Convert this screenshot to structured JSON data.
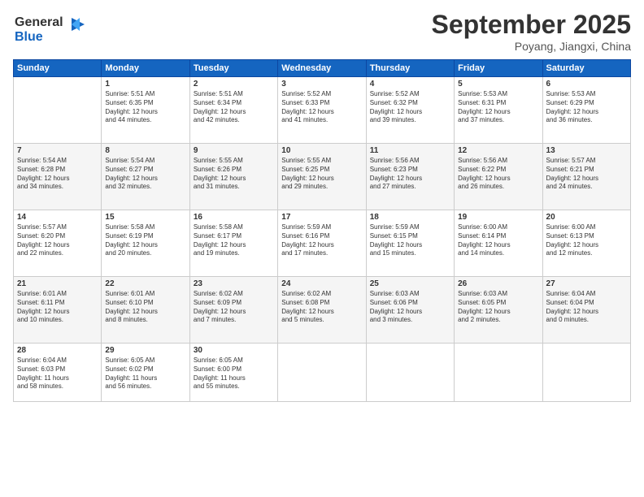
{
  "header": {
    "logo_line1": "General",
    "logo_line2": "Blue",
    "month": "September 2025",
    "location": "Poyang, Jiangxi, China"
  },
  "days_of_week": [
    "Sunday",
    "Monday",
    "Tuesday",
    "Wednesday",
    "Thursday",
    "Friday",
    "Saturday"
  ],
  "weeks": [
    [
      {
        "day": "",
        "info": ""
      },
      {
        "day": "1",
        "info": "Sunrise: 5:51 AM\nSunset: 6:35 PM\nDaylight: 12 hours\nand 44 minutes."
      },
      {
        "day": "2",
        "info": "Sunrise: 5:51 AM\nSunset: 6:34 PM\nDaylight: 12 hours\nand 42 minutes."
      },
      {
        "day": "3",
        "info": "Sunrise: 5:52 AM\nSunset: 6:33 PM\nDaylight: 12 hours\nand 41 minutes."
      },
      {
        "day": "4",
        "info": "Sunrise: 5:52 AM\nSunset: 6:32 PM\nDaylight: 12 hours\nand 39 minutes."
      },
      {
        "day": "5",
        "info": "Sunrise: 5:53 AM\nSunset: 6:31 PM\nDaylight: 12 hours\nand 37 minutes."
      },
      {
        "day": "6",
        "info": "Sunrise: 5:53 AM\nSunset: 6:29 PM\nDaylight: 12 hours\nand 36 minutes."
      }
    ],
    [
      {
        "day": "7",
        "info": "Sunrise: 5:54 AM\nSunset: 6:28 PM\nDaylight: 12 hours\nand 34 minutes."
      },
      {
        "day": "8",
        "info": "Sunrise: 5:54 AM\nSunset: 6:27 PM\nDaylight: 12 hours\nand 32 minutes."
      },
      {
        "day": "9",
        "info": "Sunrise: 5:55 AM\nSunset: 6:26 PM\nDaylight: 12 hours\nand 31 minutes."
      },
      {
        "day": "10",
        "info": "Sunrise: 5:55 AM\nSunset: 6:25 PM\nDaylight: 12 hours\nand 29 minutes."
      },
      {
        "day": "11",
        "info": "Sunrise: 5:56 AM\nSunset: 6:23 PM\nDaylight: 12 hours\nand 27 minutes."
      },
      {
        "day": "12",
        "info": "Sunrise: 5:56 AM\nSunset: 6:22 PM\nDaylight: 12 hours\nand 26 minutes."
      },
      {
        "day": "13",
        "info": "Sunrise: 5:57 AM\nSunset: 6:21 PM\nDaylight: 12 hours\nand 24 minutes."
      }
    ],
    [
      {
        "day": "14",
        "info": "Sunrise: 5:57 AM\nSunset: 6:20 PM\nDaylight: 12 hours\nand 22 minutes."
      },
      {
        "day": "15",
        "info": "Sunrise: 5:58 AM\nSunset: 6:19 PM\nDaylight: 12 hours\nand 20 minutes."
      },
      {
        "day": "16",
        "info": "Sunrise: 5:58 AM\nSunset: 6:17 PM\nDaylight: 12 hours\nand 19 minutes."
      },
      {
        "day": "17",
        "info": "Sunrise: 5:59 AM\nSunset: 6:16 PM\nDaylight: 12 hours\nand 17 minutes."
      },
      {
        "day": "18",
        "info": "Sunrise: 5:59 AM\nSunset: 6:15 PM\nDaylight: 12 hours\nand 15 minutes."
      },
      {
        "day": "19",
        "info": "Sunrise: 6:00 AM\nSunset: 6:14 PM\nDaylight: 12 hours\nand 14 minutes."
      },
      {
        "day": "20",
        "info": "Sunrise: 6:00 AM\nSunset: 6:13 PM\nDaylight: 12 hours\nand 12 minutes."
      }
    ],
    [
      {
        "day": "21",
        "info": "Sunrise: 6:01 AM\nSunset: 6:11 PM\nDaylight: 12 hours\nand 10 minutes."
      },
      {
        "day": "22",
        "info": "Sunrise: 6:01 AM\nSunset: 6:10 PM\nDaylight: 12 hours\nand 8 minutes."
      },
      {
        "day": "23",
        "info": "Sunrise: 6:02 AM\nSunset: 6:09 PM\nDaylight: 12 hours\nand 7 minutes."
      },
      {
        "day": "24",
        "info": "Sunrise: 6:02 AM\nSunset: 6:08 PM\nDaylight: 12 hours\nand 5 minutes."
      },
      {
        "day": "25",
        "info": "Sunrise: 6:03 AM\nSunset: 6:06 PM\nDaylight: 12 hours\nand 3 minutes."
      },
      {
        "day": "26",
        "info": "Sunrise: 6:03 AM\nSunset: 6:05 PM\nDaylight: 12 hours\nand 2 minutes."
      },
      {
        "day": "27",
        "info": "Sunrise: 6:04 AM\nSunset: 6:04 PM\nDaylight: 12 hours\nand 0 minutes."
      }
    ],
    [
      {
        "day": "28",
        "info": "Sunrise: 6:04 AM\nSunset: 6:03 PM\nDaylight: 11 hours\nand 58 minutes."
      },
      {
        "day": "29",
        "info": "Sunrise: 6:05 AM\nSunset: 6:02 PM\nDaylight: 11 hours\nand 56 minutes."
      },
      {
        "day": "30",
        "info": "Sunrise: 6:05 AM\nSunset: 6:00 PM\nDaylight: 11 hours\nand 55 minutes."
      },
      {
        "day": "",
        "info": ""
      },
      {
        "day": "",
        "info": ""
      },
      {
        "day": "",
        "info": ""
      },
      {
        "day": "",
        "info": ""
      }
    ]
  ]
}
